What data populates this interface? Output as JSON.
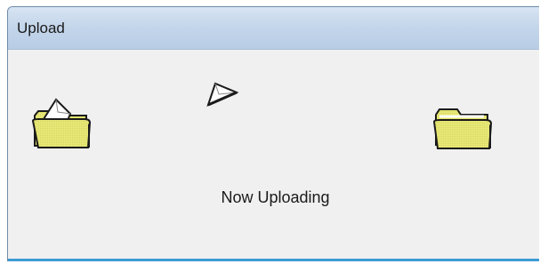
{
  "window": {
    "title": "Upload"
  },
  "animation": {
    "source_icon": "folder-open-icon",
    "moving_icon": "document-page-icon",
    "destination_icon": "folder-icon"
  },
  "status": {
    "text": "Now Uploading"
  },
  "colors": {
    "folder_fill": "#e8e87a",
    "folder_edge": "#1a1a1a",
    "titlebar": "#c3d5ea",
    "background": "#f0f0f0",
    "accent": "#3c9bd6"
  }
}
